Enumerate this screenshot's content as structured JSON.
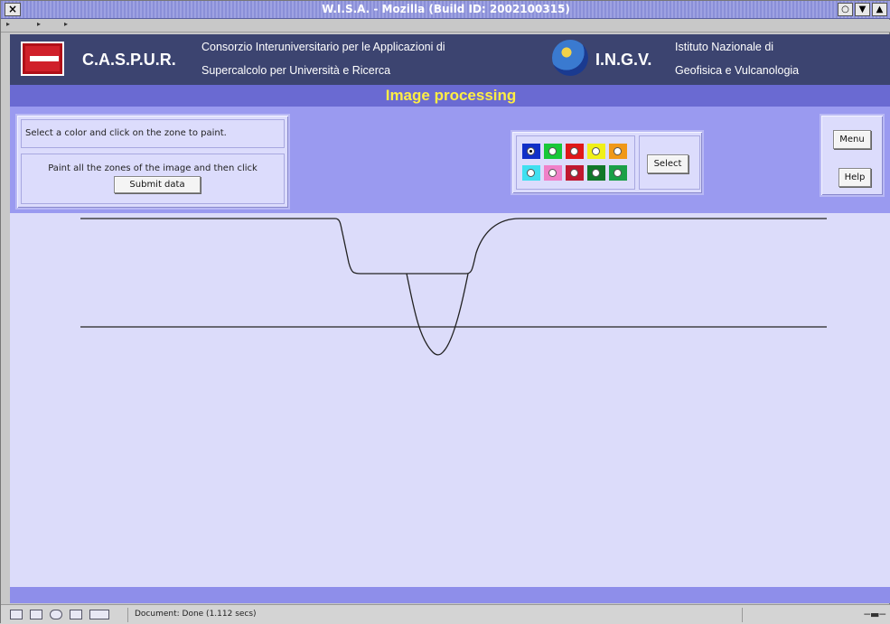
{
  "window": {
    "title": "W.I.S.A. - Mozilla (Build ID: 2002100315)",
    "close_glyph": "×",
    "controls": [
      "○",
      "▼",
      "▲"
    ]
  },
  "header": {
    "left_org": "C.A.S.P.U.R.",
    "left_desc_line1": "Consorzio Interuniversitario per le Applicazioni di",
    "left_desc_line2": "Supercalcolo per Università e Ricerca",
    "right_org": "I.N.G.V.",
    "right_desc_line1": "Istituto Nazionale di",
    "right_desc_line2": "Geofisica e Vulcanologia"
  },
  "page_title": "Image processing",
  "instructions": {
    "line1": "Select a color and click on the zone to paint.",
    "line2": "Paint all the zones of the image and then click",
    "submit_label": "Submit data"
  },
  "palette": {
    "colors": [
      "#1030c8",
      "#18c838",
      "#e01818",
      "#f0f018",
      "#f09818",
      "#40e0f0",
      "#f080c8",
      "#c01830",
      "#107828",
      "#1aa048"
    ],
    "selected_index": 0,
    "select_label": "Select"
  },
  "nav": {
    "menu_label": "Menu",
    "help_label": "Help"
  },
  "status": {
    "text": "Document: Done (1.112 secs)"
  },
  "colors": {
    "banner": "#3c4470",
    "header_bar": "#6a6ad2",
    "title_text": "#ffee44",
    "canvas": "#dcdcfa"
  }
}
